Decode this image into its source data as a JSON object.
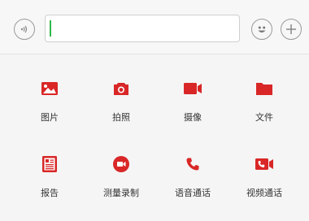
{
  "input_bar": {
    "voice_icon": "voice-icon",
    "emoji_icon": "emoji-icon",
    "plus_icon": "plus-icon",
    "message_value": "",
    "message_placeholder": ""
  },
  "accent_color": "#d92727",
  "actions": [
    {
      "label": "图片",
      "icon": "image-icon"
    },
    {
      "label": "拍照",
      "icon": "camera-icon"
    },
    {
      "label": "摄像",
      "icon": "video-camera-icon"
    },
    {
      "label": "文件",
      "icon": "folder-icon"
    },
    {
      "label": "报告",
      "icon": "report-icon"
    },
    {
      "label": "测量录制",
      "icon": "record-icon"
    },
    {
      "label": "语音通话",
      "icon": "phone-icon"
    },
    {
      "label": "视频通话",
      "icon": "video-call-icon"
    }
  ]
}
